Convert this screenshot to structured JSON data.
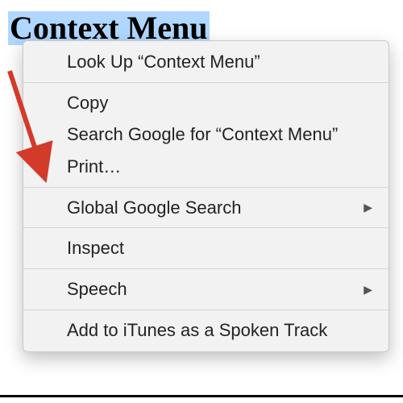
{
  "page": {
    "selected_text": "Context Menu"
  },
  "menu": {
    "lookup_label": "Look Up “Context Menu”",
    "copy_label": "Copy",
    "search_google_label": "Search Google for “Context Menu”",
    "print_label": "Print…",
    "global_search_label": "Global Google Search",
    "inspect_label": "Inspect",
    "speech_label": "Speech",
    "add_itunes_label": "Add to iTunes as a Spoken Track"
  },
  "annotation": {
    "arrow_color": "#d23a2a"
  }
}
